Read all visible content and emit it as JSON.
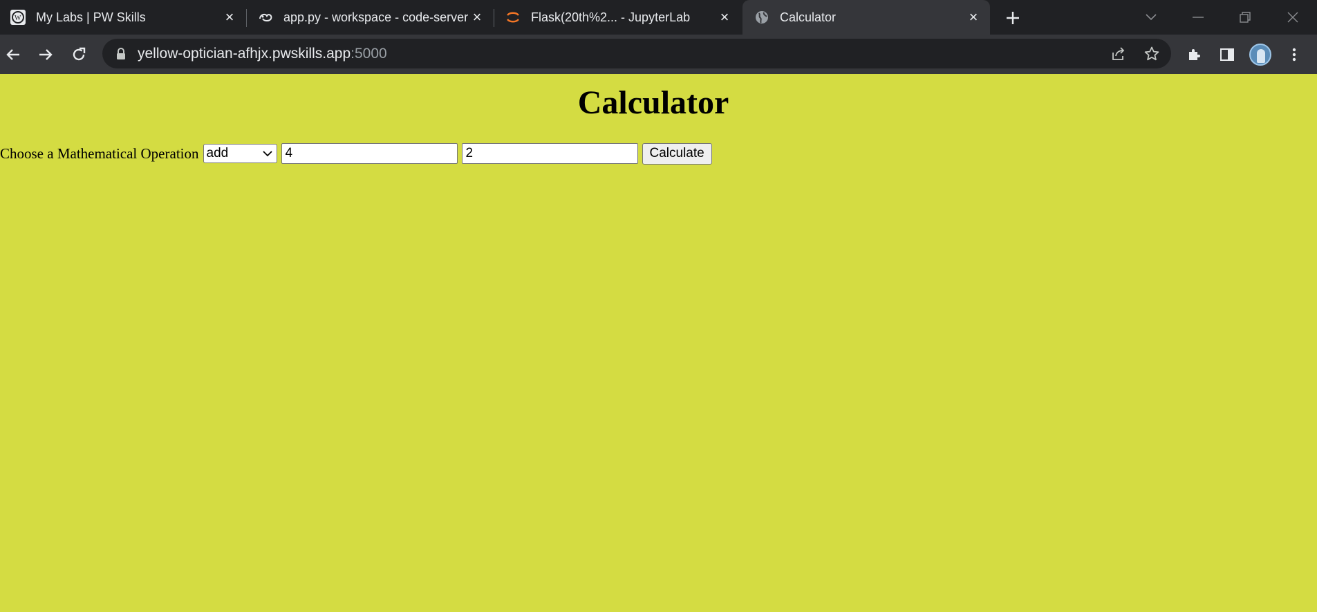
{
  "browser": {
    "tabs": [
      {
        "title": "My Labs | PW Skills",
        "icon": "pw-skills-logo-icon"
      },
      {
        "title": "app.py - workspace - code-server",
        "icon": "code-server-icon"
      },
      {
        "title": "Flask(20th%2... - JupyterLab",
        "icon": "jupyter-icon"
      },
      {
        "title": "Calculator",
        "icon": "globe-icon",
        "active": true
      }
    ],
    "address": {
      "host": "yellow-optician-afhjx.pwskills.app",
      "port": ":5000"
    }
  },
  "page": {
    "background": "#d4dc42",
    "title": "Calculator",
    "form": {
      "label": "Choose a Mathematical Operation",
      "operation": "add",
      "operand1": "4",
      "operand2": "2",
      "submit_label": "Calculate"
    }
  }
}
